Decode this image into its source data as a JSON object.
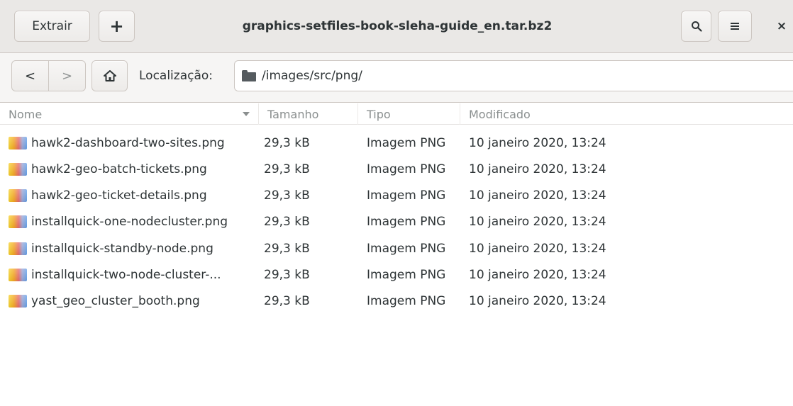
{
  "window": {
    "title": "graphics-setfiles-book-sleha-guide_en.tar.bz2"
  },
  "header": {
    "extract_label": "Extrair",
    "add_label": "+",
    "search_icon": "search-icon",
    "menu_icon": "hamburger-menu-icon",
    "close_label": "×"
  },
  "location": {
    "back_glyph": "<",
    "forward_glyph": ">",
    "home_glyph": "⌂",
    "label": "Localização:",
    "path": "/images/src/png/"
  },
  "columns": {
    "name": "Nome",
    "size": "Tamanho",
    "type": "Tipo",
    "modified": "Modificado"
  },
  "files": [
    {
      "name": "hawk2-dashboard-two-sites.png",
      "size": "29,3 kB",
      "type": "Imagem PNG",
      "modified": "10 janeiro 2020, 13:24"
    },
    {
      "name": "hawk2-geo-batch-tickets.png",
      "size": "29,3 kB",
      "type": "Imagem PNG",
      "modified": "10 janeiro 2020, 13:24"
    },
    {
      "name": "hawk2-geo-ticket-details.png",
      "size": "29,3 kB",
      "type": "Imagem PNG",
      "modified": "10 janeiro 2020, 13:24"
    },
    {
      "name": "installquick-one-nodecluster.png",
      "size": "29,3 kB",
      "type": "Imagem PNG",
      "modified": "10 janeiro 2020, 13:24"
    },
    {
      "name": "installquick-standby-node.png",
      "size": "29,3 kB",
      "type": "Imagem PNG",
      "modified": "10 janeiro 2020, 13:24"
    },
    {
      "name": "installquick-two-node-cluster-...",
      "size": "29,3 kB",
      "type": "Imagem PNG",
      "modified": "10 janeiro 2020, 13:24"
    },
    {
      "name": "yast_geo_cluster_booth.png",
      "size": "29,3 kB",
      "type": "Imagem PNG",
      "modified": "10 janeiro 2020, 13:24"
    }
  ]
}
